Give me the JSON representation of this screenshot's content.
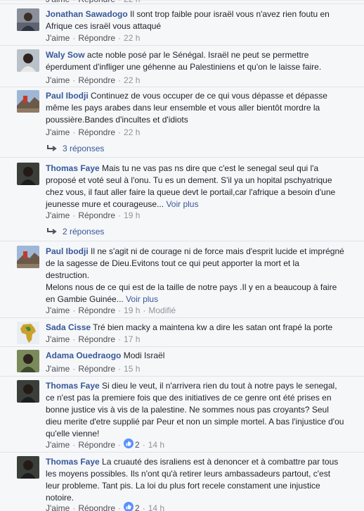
{
  "comments": [
    {
      "author": "Jonathan Sawadogo",
      "text": "Il sont trop faible pour israël vous n'avez rien foutu en Afrique ces israël vous attaqué",
      "like_label": "J'aime",
      "reply_label": "Répondre",
      "time": "22 h",
      "avatar_icon": "person-icon"
    },
    {
      "author": "Waly Sow",
      "text": "acte noble posé par le Sénégal. Israël ne peut se permettre éperdument d'infliger une géhenne au Palestiniens et qu'on le laisse faire.",
      "like_label": "J'aime",
      "reply_label": "Répondre",
      "time": "22 h",
      "avatar_icon": "person-icon"
    },
    {
      "author": "Paul Ibodji",
      "text": "Continuez de vous occuper de ce qui vous dépasse et dépasse même les pays arabes dans leur ensemble et vous aller bientôt mordre la poussière.Bandes d'incultes et d'idiots",
      "like_label": "J'aime",
      "reply_label": "Répondre",
      "time": "22 h",
      "avatar_icon": "landscape-icon",
      "replies_label": "3 réponses"
    },
    {
      "author": "Thomas Faye",
      "text": "Mais tu ne vas pas ns dire que c'est le senegal seul qui l'a proposé et voté seul à l'onu. Tu es un dement. S'il ya un hopital pschyatrique chez vous, il faut aller faire la queue devt le portail,car l'afrique a besoin d'une jeunesse mure et courageuse...",
      "more_label": "Voir plus",
      "like_label": "J'aime",
      "reply_label": "Répondre",
      "time": "19 h",
      "avatar_icon": "person-icon",
      "replies_label": "2 réponses"
    },
    {
      "author": "Paul Ibodji",
      "text": "Il ne s'agit ni de courage ni de force mais d'esprit lucide et imprégné de la sagesse de Dieu.Evitons tout ce qui peut apporter la mort et la destruction.",
      "text2": "Melons nous de ce qui est de la taille de notre pays .Il y en a beaucoup à faire en Gambie Guinée...",
      "more_label": "Voir plus",
      "like_label": "J'aime",
      "reply_label": "Répondre",
      "time": "19 h",
      "edited_label": "Modifié",
      "avatar_icon": "landscape-icon"
    },
    {
      "author": "Sada Cisse",
      "text": "Tré bien macky a maintena kw a dire les satan ont frapé la porte",
      "like_label": "J'aime",
      "reply_label": "Répondre",
      "time": "17 h",
      "avatar_icon": "africa-map-icon"
    },
    {
      "author": "Adama Ouedraogo",
      "text": "Modi Israël",
      "like_label": "J'aime",
      "reply_label": "Répondre",
      "time": "15 h",
      "avatar_icon": "person-icon"
    },
    {
      "author": "Thomas Faye",
      "text": "Si dieu le veut, il n'arrivera rien du tout à notre pays le senegal, ce n'est pas la premiere fois que des initiatives de ce genre ont été prises en bonne justice vis à vis de la palestine. Ne sommes nous pas croyants? Seul dieu merite d'etre supplié par Peur et non un simple mortel. A bas l'injustice d'ou qu'elle vienne!",
      "like_label": "J'aime",
      "reply_label": "Répondre",
      "reactions": "2",
      "time": "14 h",
      "avatar_icon": "person-icon"
    },
    {
      "author": "Thomas Faye",
      "text": "La cruauté des israliens est à denoncer et à combattre par tous les moyens possibles. Ils n'ont qu'à retirer leurs ambassadeurs partout, c'est leur probleme. Tant pis. La loi du plus fort recele constament une injustice notoire.",
      "like_label": "J'aime",
      "reply_label": "Répondre",
      "reactions": "2",
      "time": "14 h",
      "avatar_icon": "person-icon"
    }
  ],
  "colors": {
    "link": "#365899",
    "meta": "#90949c",
    "like_blue": "#5890ff"
  }
}
